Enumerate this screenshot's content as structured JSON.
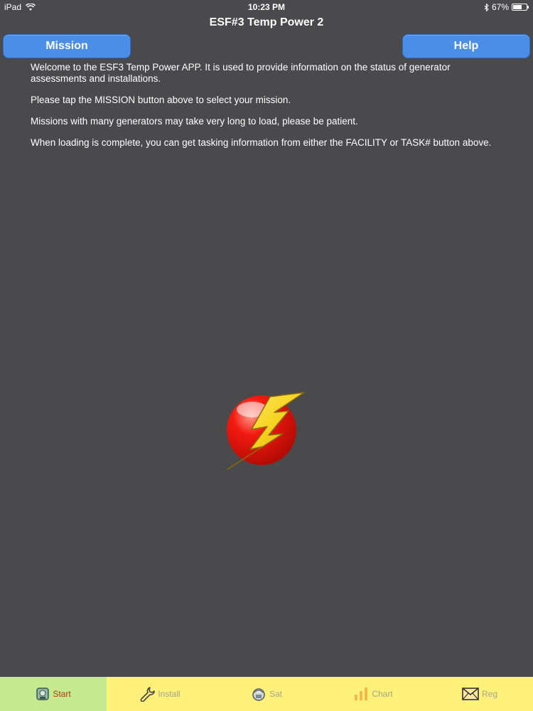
{
  "status_bar": {
    "device": "iPad",
    "time": "10:23 PM",
    "battery": "67%",
    "battery_level": 0.67
  },
  "header": {
    "title": "ESF#3 Temp Power 2",
    "mission_label": "Mission",
    "help_label": "Help"
  },
  "content": {
    "paragraphs": [
      "Welcome to the ESF3 Temp Power APP.  It is used to provide information on the status of generator assessments and installations.",
      "Please tap the MISSION button above to select your mission.",
      "Missions with many generators may take very long to load, please be patient.",
      "When loading is complete, you can get tasking information from either the FACILITY or TASK# button above."
    ]
  },
  "tabs": [
    {
      "label": "Start",
      "icon": "start-icon",
      "active": true
    },
    {
      "label": "Install",
      "icon": "wrench-icon",
      "active": false
    },
    {
      "label": "Sat",
      "icon": "sat-icon",
      "active": false
    },
    {
      "label": "Chart",
      "icon": "chart-icon",
      "active": false
    },
    {
      "label": "Reg",
      "icon": "envelope-icon",
      "active": false
    }
  ],
  "colors": {
    "background": "#4a4a4c",
    "button": "#4a8ee8",
    "tab_bar": "#fdf17a",
    "tab_active": "#c4ea8f",
    "tab_active_text": "#b8330b"
  }
}
